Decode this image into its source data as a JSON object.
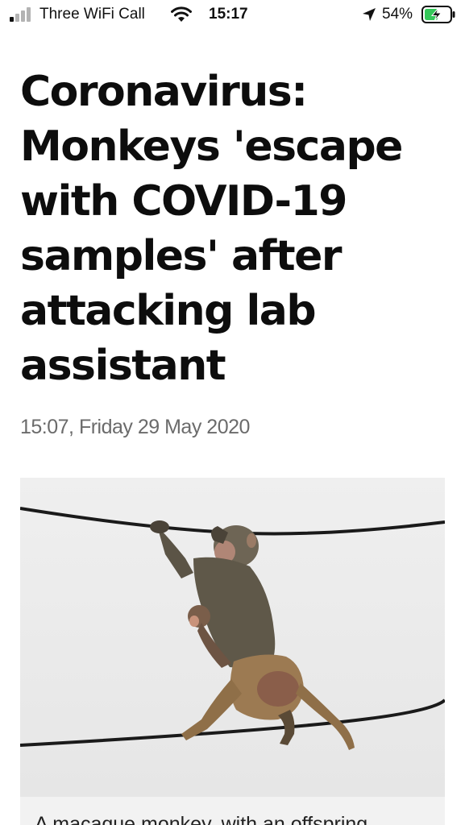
{
  "status_bar": {
    "carrier": "Three WiFi Call",
    "time": "15:17",
    "battery_percent": "54%",
    "battery_level": 0.54,
    "icons": [
      "signal-icon",
      "wifi-icon",
      "location-arrow-icon",
      "battery-charging-icon"
    ]
  },
  "article": {
    "headline": "Coronavirus: Monkeys 'escape with COVID-19 samples' after attacking lab assistant",
    "timestamp": "15:07, Friday 29 May 2020",
    "image": {
      "subject": "monkey-photo"
    },
    "caption": "A macaque monkey, with an offspring"
  },
  "colors": {
    "text": "#0d0d0d",
    "timestamp": "#6b6b6b",
    "photo_bg": "#eeeeee",
    "battery_charging": "#34c759"
  }
}
